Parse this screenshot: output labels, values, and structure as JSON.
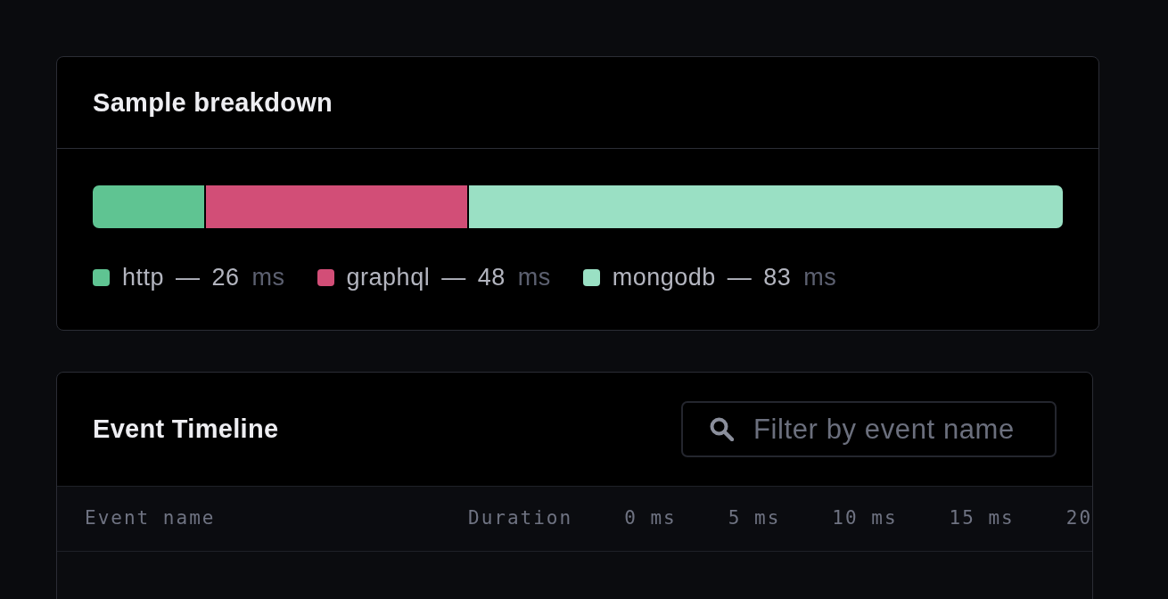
{
  "breakdown": {
    "title": "Sample breakdown",
    "segments": [
      {
        "label": "http — 26",
        "unit": "ms",
        "color": "#5fc492",
        "level": 0.1152
      },
      {
        "label": "graphql — 48",
        "unit": "ms",
        "color": "#d24e77",
        "level": 0.2687
      },
      {
        "label": "mongodb — 83",
        "unit": "ms",
        "color": "#9ae0c4",
        "level": 0.6124
      }
    ]
  },
  "timeline": {
    "title": "Event Timeline",
    "search": {
      "placeholder": "Filter by event name"
    },
    "table": {
      "columns": [
        "Event name",
        "Duration"
      ],
      "ticks": [
        "0 ms",
        "5 ms",
        "10 ms",
        "15 ms",
        "20"
      ]
    }
  }
}
